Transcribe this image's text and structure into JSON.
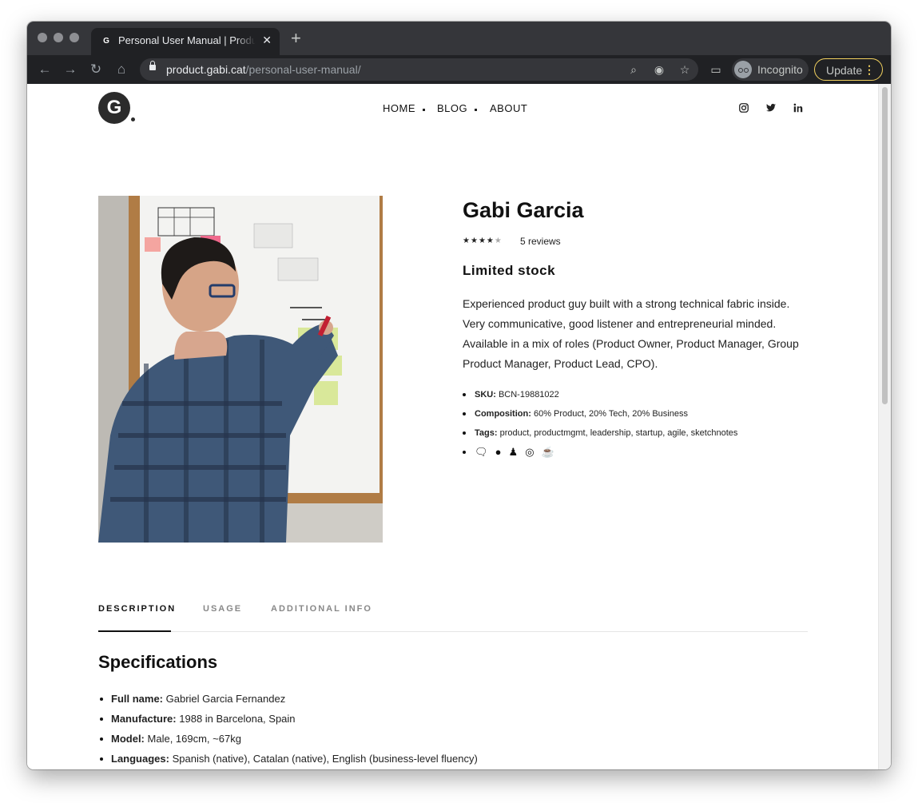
{
  "browser": {
    "tab_title": "Personal User Manual | Product",
    "tab_favicon": "G",
    "url_host": "product.gabi.cat",
    "url_path": "/personal-user-manual/",
    "incognito_label": "Incognito",
    "update_label": "Update"
  },
  "site": {
    "logo_letter": "G",
    "nav": [
      "HOME",
      "BLOG",
      "ABOUT"
    ],
    "social_icons": [
      "instagram-icon",
      "twitter-icon",
      "linkedin-icon"
    ]
  },
  "product": {
    "title": "Gabi Garcia",
    "rating": 4,
    "rating_max": 5,
    "reviews": "5 reviews",
    "stock": "Limited stock",
    "description": "Experienced product guy built with a strong technical fabric inside. Very communicative, good listener and entrepreneurial minded. Available in a mix of roles (Product Owner, Product Manager, Group Product Manager, Product Lead, CPO).",
    "meta": {
      "sku_label": "SKU:",
      "sku_value": "BCN-19881022",
      "composition_label": "Composition:",
      "composition_value": "60% Product, 20% Tech, 20% Business",
      "tags_label": "Tags:",
      "tags_value": "product, productmgmt, leadership, startup, agile, sketchnotes",
      "icons": [
        "chat-bubbles-icon",
        "apple-icon",
        "team-icon",
        "target-icon",
        "coffee-icon"
      ]
    },
    "image_alt": "Man writing on a whiteboard with sticky notes"
  },
  "tabs": [
    "DESCRIPTION",
    "USAGE",
    "ADDITIONAL INFO"
  ],
  "specifications": {
    "title": "Specifications",
    "items": [
      {
        "label": "Full name:",
        "value": "Gabriel Garcia Fernandez"
      },
      {
        "label": "Manufacture:",
        "value": "1988 in Barcelona, Spain"
      },
      {
        "label": "Model:",
        "value": "Male, 169cm, ~67kg"
      },
      {
        "label": "Languages:",
        "value": "Spanish (native), Catalan (native), English (business-level fluency)"
      }
    ]
  }
}
